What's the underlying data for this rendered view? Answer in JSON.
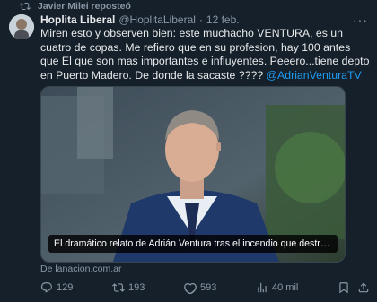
{
  "repost": {
    "label": "Javier Milei reposteó"
  },
  "author": {
    "name": "Hoplita Liberal",
    "handle": "@HoplitaLiberal",
    "separator": "·",
    "date": "12 feb."
  },
  "post": {
    "text_main": "Miren esto y observen bien: este muchacho VENTURA, es un cuatro de copas. Me refiero que en su profesion, hay 100 antes que El que son mas importantes e influyentes. Peeero...tiene depto en Puerto Madero. De donde la sacaste ???? ",
    "mention": "@AdrianVenturaTV"
  },
  "media": {
    "caption": "El dramático relato de Adrián Ventura tras el incendio que destruyó parte de su...",
    "source": "De lanacion.com.ar"
  },
  "actions": {
    "replies": "129",
    "reposts": "193",
    "likes": "593",
    "views": "40 mil"
  },
  "colors": {
    "background": "#15202b",
    "accent": "#1d9bf0",
    "muted": "#8b98a5",
    "text": "#e7e9ea"
  }
}
